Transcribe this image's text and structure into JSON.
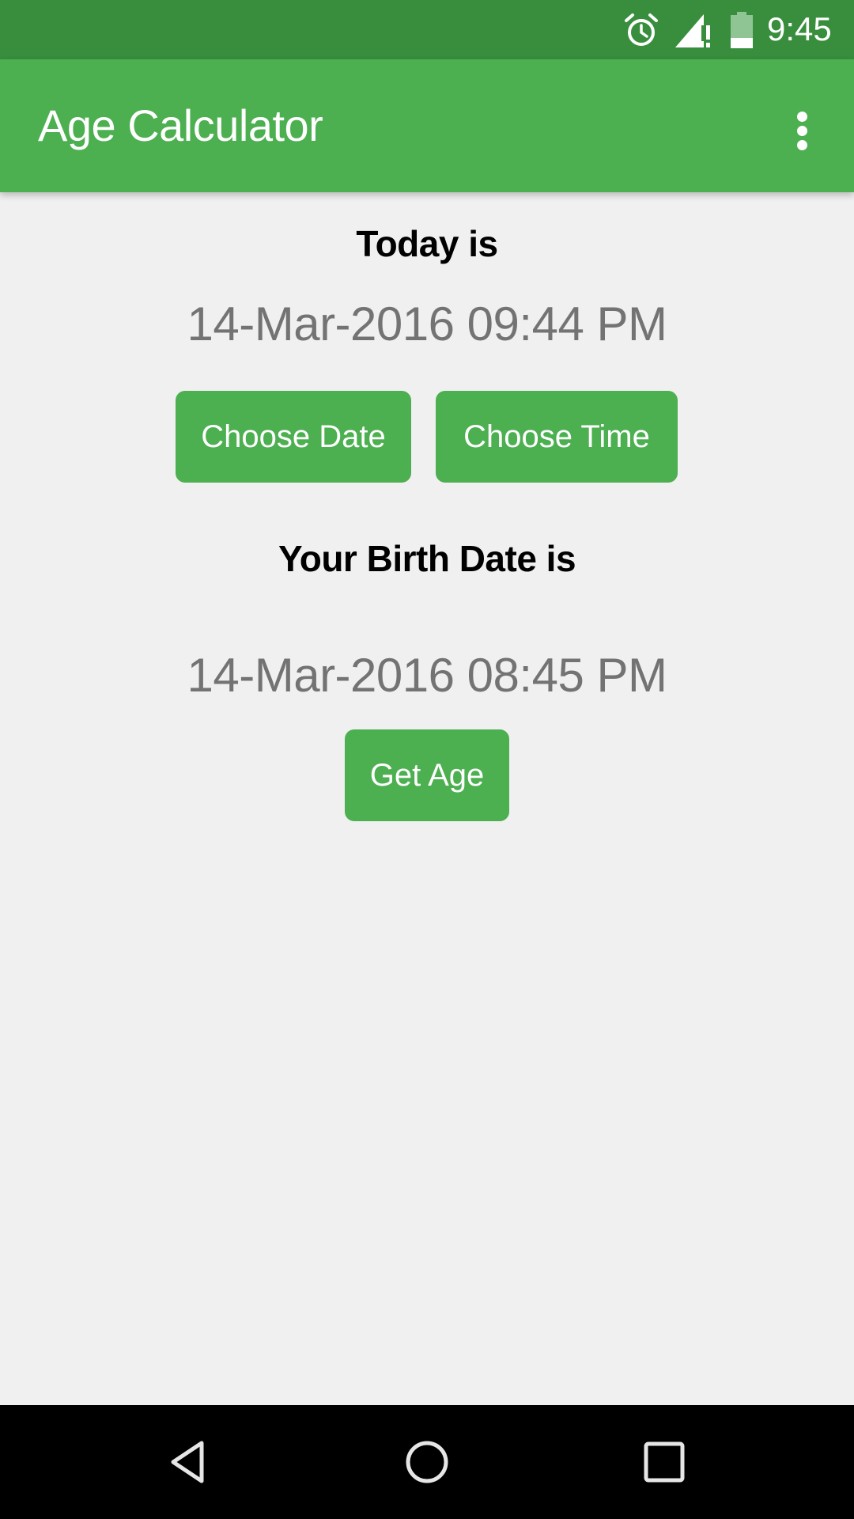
{
  "status_bar": {
    "time": "9:45",
    "icons": [
      "alarm-icon",
      "signal-icon",
      "battery-icon"
    ],
    "color": "#388E3C"
  },
  "toolbar": {
    "title": "Age Calculator",
    "overflow_icon": "more-vert-icon",
    "color": "#4CAF50"
  },
  "today": {
    "heading": "Today is",
    "value": "14-Mar-2016 09:44 PM",
    "choose_date_label": "Choose Date",
    "choose_time_label": "Choose Time"
  },
  "birth": {
    "heading": "Your Birth Date is",
    "value": "14-Mar-2016 08:45 PM",
    "get_age_label": "Get Age"
  },
  "nav_bar": {
    "buttons": [
      "back-icon",
      "home-icon",
      "recents-icon"
    ]
  }
}
